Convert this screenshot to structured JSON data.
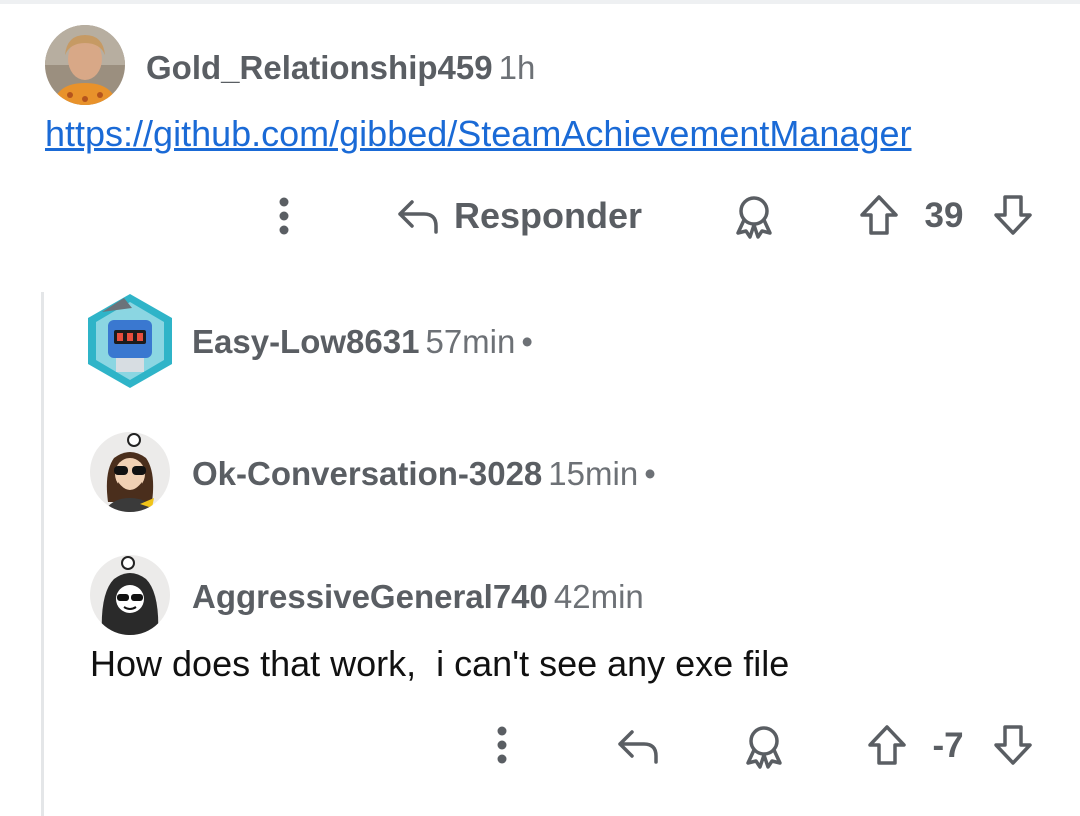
{
  "comments": [
    {
      "username": "Gold_Relationship459",
      "time": "1h",
      "link": "https://github.com/gibbed/SteamAchievementManager",
      "actions": {
        "reply_label": "Responder",
        "score": "39"
      }
    },
    {
      "username": "Easy-Low8631",
      "time": "57min",
      "dot": "•"
    },
    {
      "username": "Ok-Conversation-3028",
      "time": "15min",
      "dot": "•"
    },
    {
      "username": "AggressiveGeneral740",
      "time": "42min",
      "body": "How does that work,  i can't see any exe file",
      "actions": {
        "score": "-7"
      }
    }
  ],
  "icons": {
    "more": "more-vertical-icon",
    "reply": "reply-arrow-icon",
    "award": "award-icon",
    "upvote": "upvote-arrow-icon",
    "downvote": "downvote-arrow-icon"
  },
  "colors": {
    "link": "#1a6ad6",
    "muted": "#5a5e63",
    "thread_line": "#e4e6e8"
  }
}
